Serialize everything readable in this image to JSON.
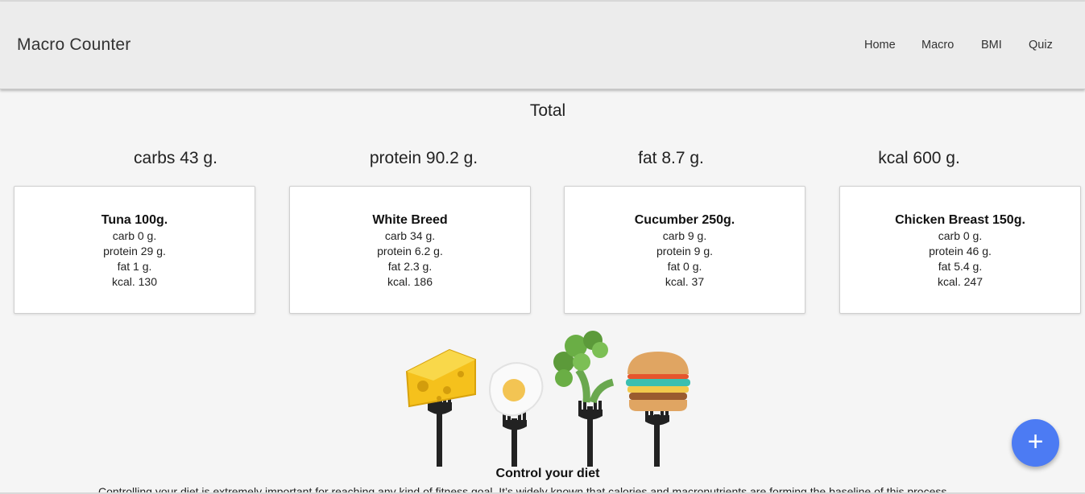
{
  "header": {
    "brand": "Macro Counter",
    "nav": [
      "Home",
      "Macro",
      "BMI",
      "Quiz"
    ]
  },
  "totals": {
    "title": "Total",
    "carbs": "carbs 43 g.",
    "protein": "protein 90.2 g.",
    "fat": "fat 8.7 g.",
    "kcal": "kcal 600 g."
  },
  "foods": [
    {
      "name": "Tuna 100g.",
      "carb": "carb 0 g.",
      "protein": "protein 29 g.",
      "fat": "fat 1 g.",
      "kcal": "kcal. 130"
    },
    {
      "name": "White Breed",
      "carb": "carb 34 g.",
      "protein": "protein 6.2 g.",
      "fat": "fat 2.3 g.",
      "kcal": "kcal. 186"
    },
    {
      "name": "Cucumber 250g.",
      "carb": "carb 9 g.",
      "protein": "protein 9 g.",
      "fat": "fat 0 g.",
      "kcal": "kcal. 37"
    },
    {
      "name": "Chicken Breast 150g.",
      "carb": "carb 0 g.",
      "protein": "protein 46 g.",
      "fat": "fat 5.4 g.",
      "kcal": "kcal. 247"
    }
  ],
  "diet": {
    "title": "Control your diet",
    "text": "Controlling your diet is extremely important for reaching any kind of fitness goal. It’s widely known that calories and macronutrients are forming the baseline of this process."
  },
  "fab": {
    "icon": "plus-icon",
    "symbol": "+",
    "color": "#4c7bf3"
  }
}
